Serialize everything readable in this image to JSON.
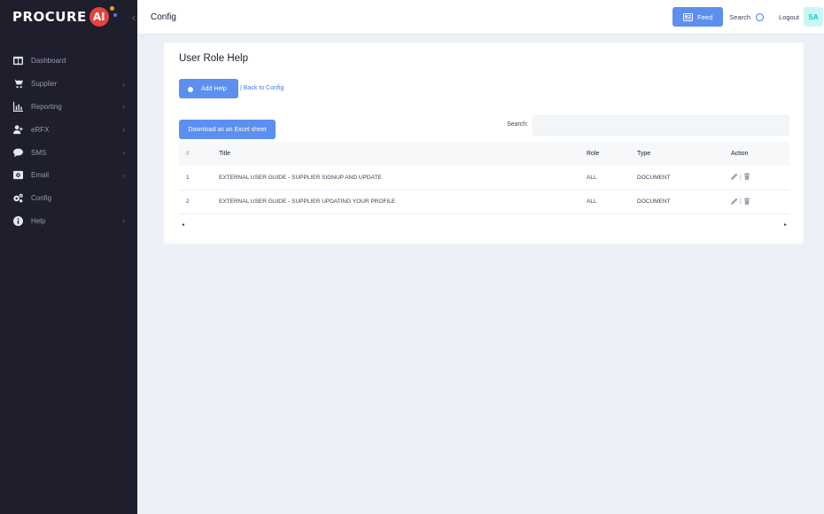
{
  "brand": {
    "name": "PROCURE",
    "ai": "AI"
  },
  "sidebar": {
    "items": [
      {
        "label": "Dashboard",
        "icon": "dashboard-icon",
        "has_children": false
      },
      {
        "label": "Supplier",
        "icon": "cart-icon",
        "has_children": true
      },
      {
        "label": "Reporting",
        "icon": "chart-icon",
        "has_children": true
      },
      {
        "label": "eRFX",
        "icon": "user-plus-icon",
        "has_children": true
      },
      {
        "label": "SMS",
        "icon": "chat-icon",
        "has_children": true
      },
      {
        "label": "Email",
        "icon": "envelope-icon",
        "has_children": true
      },
      {
        "label": "Config",
        "icon": "cogs-icon",
        "has_children": false
      },
      {
        "label": "Help",
        "icon": "info-icon",
        "has_children": true
      }
    ]
  },
  "header": {
    "title": "Config",
    "feed_label": "Feed",
    "search_label": "Search",
    "logout_label": "Logout",
    "avatar_initials": "SA"
  },
  "card": {
    "title": "User Role Help",
    "add_button": "Add Help",
    "back_link": "| Back to Config",
    "excel_button": "Download as an Excel sheet",
    "search_label": "Search:",
    "search_value": ""
  },
  "table": {
    "columns": [
      "#",
      "Title",
      "Role",
      "Type",
      "Action"
    ],
    "rows": [
      {
        "num": "1",
        "title": "EXTERNAL USER GUIDE - SUPPLIER SIGNUP AND UPDATE",
        "role": "ALL",
        "type": "DOCUMENT"
      },
      {
        "num": "2",
        "title": "EXTERNAL USER GUIDE - SUPPLIER UPDATING YOUR PROFILE",
        "role": "ALL",
        "type": "DOCUMENT"
      }
    ],
    "action_separator": "|"
  },
  "scroll": {
    "left": "◂",
    "right": "▸"
  },
  "colors": {
    "sidebar_bg": "#1e1e2d",
    "primary": "#5c8ff0",
    "page_bg": "#eef0f7",
    "brand_ai": "#e8413c"
  }
}
